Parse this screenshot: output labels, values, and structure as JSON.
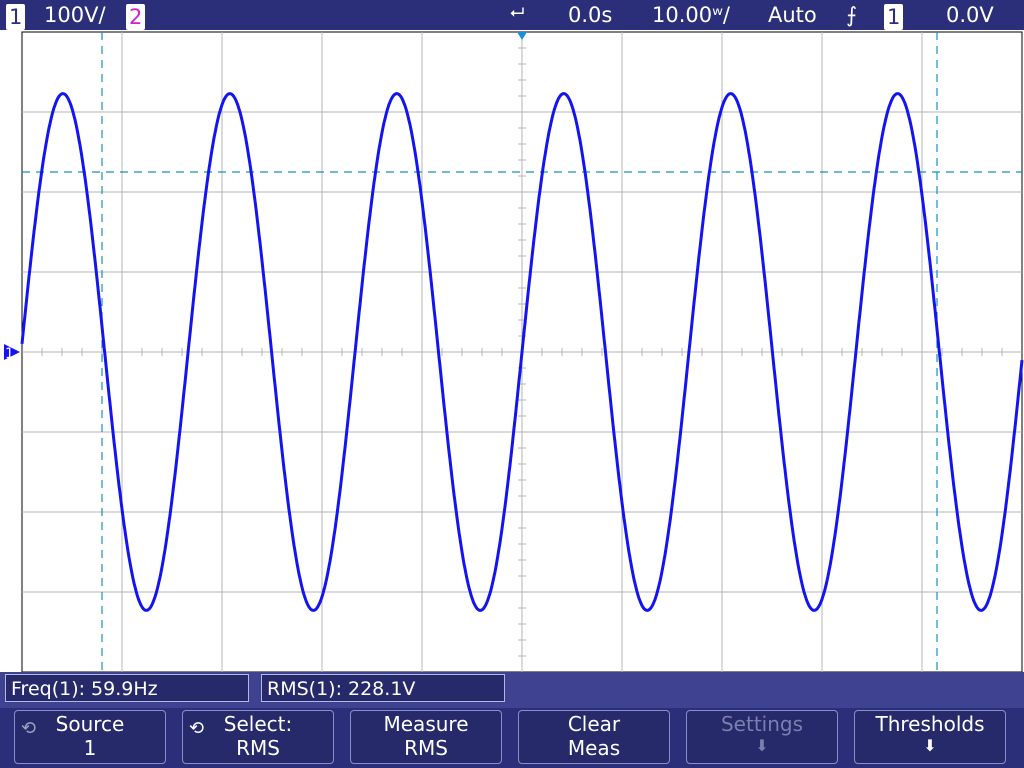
{
  "header": {
    "ch1_label": "1",
    "ch1_scale": "100V/",
    "ch2_label": "2",
    "delay": "0.0s",
    "timebase": "10.00ʷ/",
    "trigger_mode": "Auto",
    "trigger_slope_icon": "rising-edge-icon",
    "trigger_source": "1",
    "trigger_level": "0.0V"
  },
  "ground_marker": "1",
  "colors": {
    "trace": "#1414f0",
    "cursor": "#1a8fbf",
    "bar": "#2b2f7a",
    "grid": "#b4b4b4"
  },
  "measurements": [
    {
      "label": "Freq(1): 59.9Hz"
    },
    {
      "label": "RMS(1): 228.1V"
    }
  ],
  "softkeys": [
    {
      "line1": "Source",
      "line2": "1",
      "icon": "rotary-knob-icon",
      "enabled": true
    },
    {
      "line1": "Select:",
      "line2": "RMS",
      "icon": "rotary-knob-icon",
      "enabled": true
    },
    {
      "line1": "Measure",
      "line2": "RMS",
      "enabled": true
    },
    {
      "line1": "Clear",
      "line2": "Meas",
      "enabled": true
    },
    {
      "line1": "Settings",
      "line2": "⬇",
      "enabled": false
    },
    {
      "line1": "Thresholds",
      "line2": "⬇",
      "enabled": true
    }
  ],
  "chart_data": {
    "type": "line",
    "title": "",
    "xlabel": "",
    "ylabel": "",
    "time_per_div_ms": 10,
    "volts_per_div": 100,
    "divisions_x": 10,
    "divisions_y": 8,
    "xlim_ms": [
      -50,
      50
    ],
    "ylim_V": [
      -400,
      400
    ],
    "grid": true,
    "series": [
      {
        "frequency_Hz": 59.9,
        "amplitude_V": 323,
        "phase_deg": 0,
        "rms_V": 228.1
      }
    ],
    "cursors": {
      "x_ms": [
        -42,
        41.5
      ],
      "y_V": [
        225
      ]
    }
  }
}
